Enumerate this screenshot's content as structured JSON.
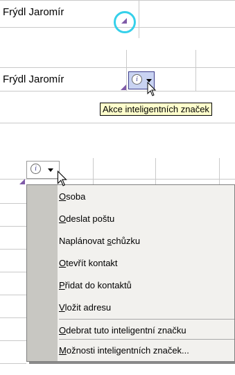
{
  "panel1": {
    "cell_text": "Frýdl Jaromír"
  },
  "panel2": {
    "cell_text": "Frýdl Jaromír",
    "tooltip": "Akce inteligentních značek"
  },
  "panel3": {
    "menu_items": [
      {
        "pre": "",
        "u": "O",
        "post": "soba"
      },
      {
        "pre": "",
        "u": "O",
        "post": "deslat poštu"
      },
      {
        "pre": "Naplánovat ",
        "u": "s",
        "post": "chůzku"
      },
      {
        "pre": "",
        "u": "O",
        "post": "tevřít kontakt"
      },
      {
        "pre": "",
        "u": "P",
        "post": "řidat do kontaktů"
      },
      {
        "pre": "",
        "u": "V",
        "post": "ložit adresu"
      },
      {
        "pre": "",
        "u": "O",
        "post": "debrat tuto inteligentní značku"
      },
      {
        "pre": "",
        "u": "M",
        "post": "ožnosti inteligentních značek..."
      }
    ]
  },
  "icons": {
    "smart_tag": "smart-tag-info-icon",
    "dropdown": "dropdown-arrow-icon",
    "cursor": "mouse-pointer-icon",
    "indicator": "smart-tag-indicator-icon"
  },
  "colors": {
    "highlight_ring": "#35d0ea",
    "indicator": "#7f5aa8",
    "button_hover": "#c9d3f2",
    "tooltip_bg": "#ffffcc",
    "menu_gutter": "#c8c7c2"
  }
}
